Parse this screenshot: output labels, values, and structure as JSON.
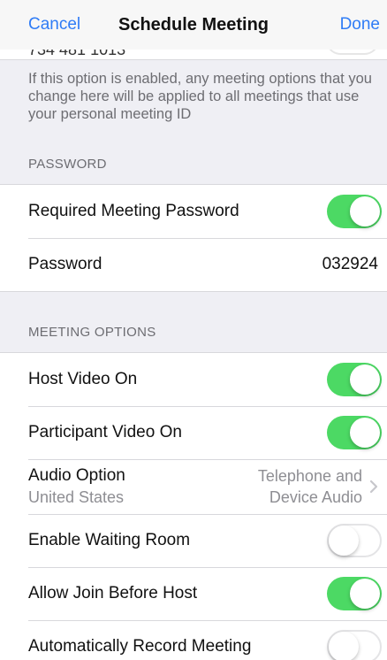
{
  "nav": {
    "cancel_label": "Cancel",
    "title": "Schedule Meeting",
    "done_label": "Done"
  },
  "cutoff_row": {
    "text": "734 481 1013"
  },
  "note": "If this option is enabled, any meeting options that you change here will be applied to all meetings that use your personal meeting ID",
  "password_section": {
    "header": "PASSWORD",
    "required_label": "Required Meeting Password",
    "required_on": true,
    "password_label": "Password",
    "password_value": "032924"
  },
  "meeting_options": {
    "header": "MEETING OPTIONS",
    "host_video_label": "Host Video On",
    "host_video_on": true,
    "participant_video_label": "Participant Video On",
    "participant_video_on": true,
    "audio_option_label": "Audio Option",
    "audio_option_sub": "United States",
    "audio_option_value_line1": "Telephone and",
    "audio_option_value_line2": "Device Audio",
    "waiting_room_label": "Enable Waiting Room",
    "waiting_room_on": false,
    "join_before_host_label": "Allow Join Before Host",
    "join_before_host_on": true,
    "auto_record_label": "Automatically Record Meeting",
    "auto_record_on": false
  },
  "colors": {
    "accent": "#2f7cf6",
    "toggle_on": "#4cd964",
    "background": "#efeff4",
    "secondary_text": "#6d6d72"
  }
}
